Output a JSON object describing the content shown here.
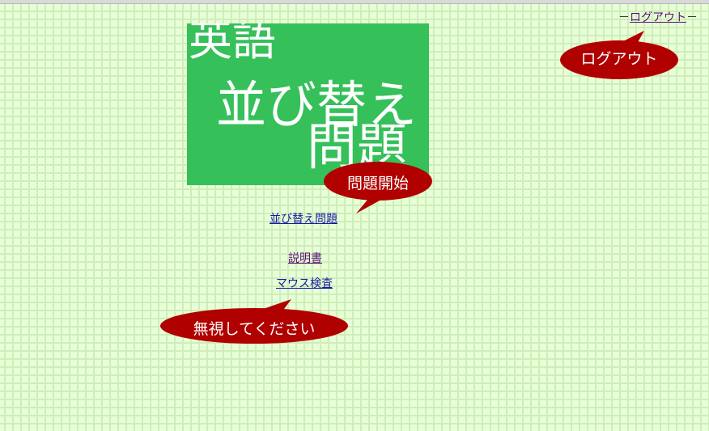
{
  "header": {
    "logout_link": "ログアウト",
    "dash_left": "－",
    "dash_right": "－"
  },
  "logo": {
    "line1": "英語",
    "line2": "並び替え",
    "line3": "問題",
    "background_color": "#35c05a"
  },
  "links": {
    "sort_problem": "並び替え問題",
    "manual": "説明書",
    "mouse_check": "マウス検査"
  },
  "callouts": {
    "logout": "ログアウト",
    "start": "問題開始",
    "ignore": "無視してください",
    "color": "#b00000"
  }
}
